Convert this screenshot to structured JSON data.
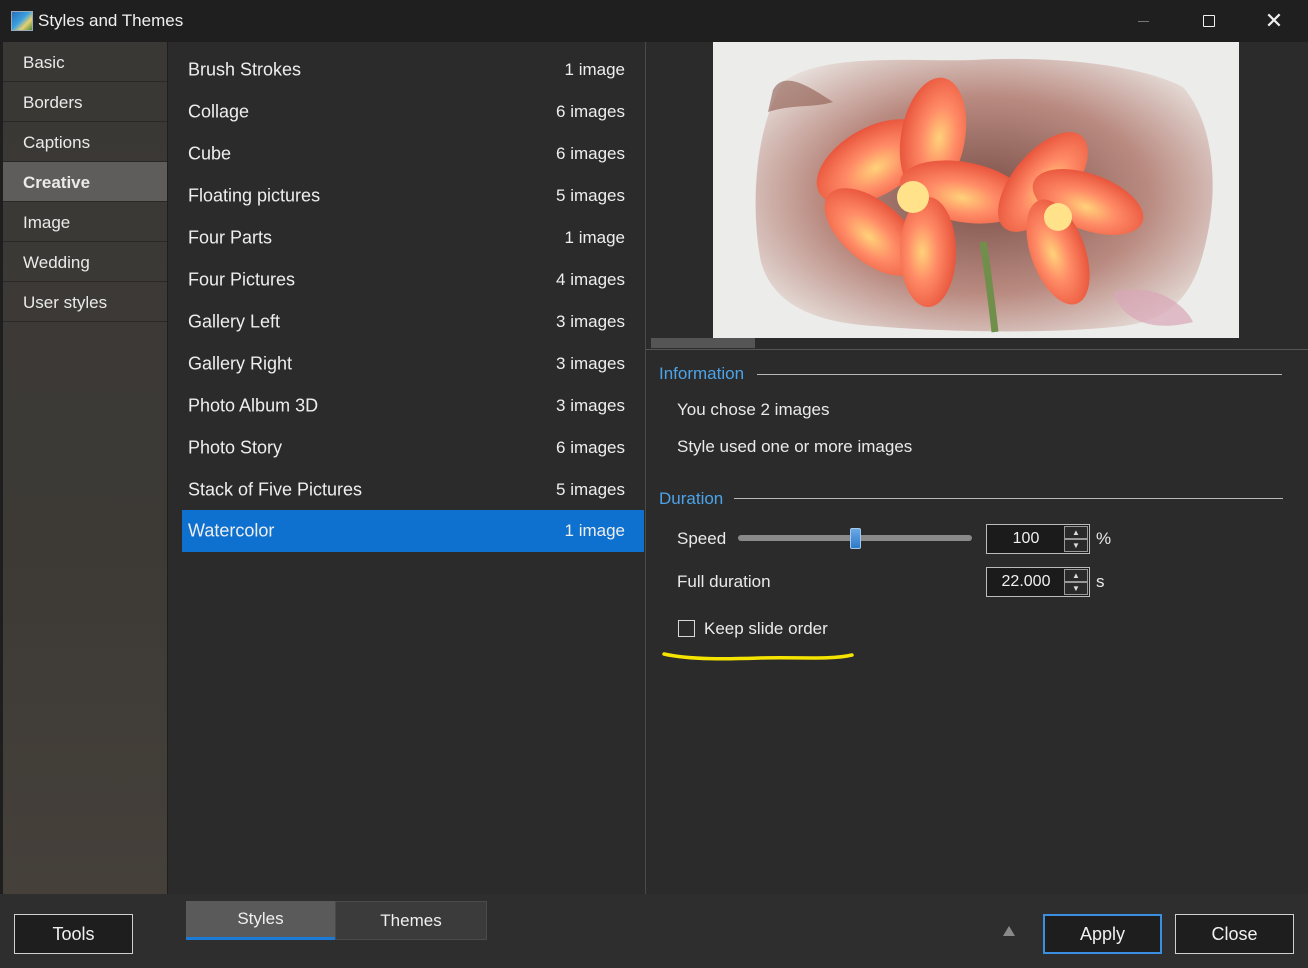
{
  "window": {
    "title": "Styles and Themes",
    "minimize_icon": "minimize-icon",
    "maximize_icon": "maximize-icon",
    "close_glyph": "✕"
  },
  "categories": [
    {
      "label": "Basic",
      "selected": false
    },
    {
      "label": "Borders",
      "selected": false
    },
    {
      "label": "Captions",
      "selected": false
    },
    {
      "label": "Creative",
      "selected": true
    },
    {
      "label": "Image",
      "selected": false
    },
    {
      "label": "Wedding",
      "selected": false
    },
    {
      "label": "User styles",
      "selected": false
    }
  ],
  "styles": [
    {
      "name": "Brush Strokes",
      "count": "1 image"
    },
    {
      "name": "Collage",
      "count": "6 images"
    },
    {
      "name": "Cube",
      "count": "6 images"
    },
    {
      "name": "Floating pictures",
      "count": "5 images"
    },
    {
      "name": "Four Parts",
      "count": "1 image"
    },
    {
      "name": "Four Pictures",
      "count": "4 images"
    },
    {
      "name": "Gallery Left",
      "count": "3 images"
    },
    {
      "name": "Gallery Right",
      "count": "3 images"
    },
    {
      "name": "Photo Album 3D",
      "count": "3 images"
    },
    {
      "name": "Photo Story",
      "count": "6 images"
    },
    {
      "name": "Stack of Five Pictures",
      "count": "5 images"
    },
    {
      "name": "Watercolor",
      "count": "1 image",
      "selected": true
    }
  ],
  "information": {
    "title": "Information",
    "line1": "You chose 2 images",
    "line2": "Style used one or more images"
  },
  "duration": {
    "title": "Duration",
    "speed_label": "Speed",
    "speed_value": "100",
    "speed_unit": "%",
    "speed_slider_fraction": 0.5,
    "full_duration_label": "Full duration",
    "full_duration_value": "22.000",
    "full_duration_unit": "s",
    "keep_slide_order_label": "Keep slide order",
    "keep_slide_order_checked": false
  },
  "bottom": {
    "tools_label": "Tools",
    "tab_styles": "Styles",
    "tab_themes": "Themes",
    "apply_label": "Apply",
    "close_label": "Close"
  },
  "colors": {
    "accent": "#0e70cf",
    "section_title": "#4da3e8",
    "highlight_annotation": "#f5e400"
  }
}
